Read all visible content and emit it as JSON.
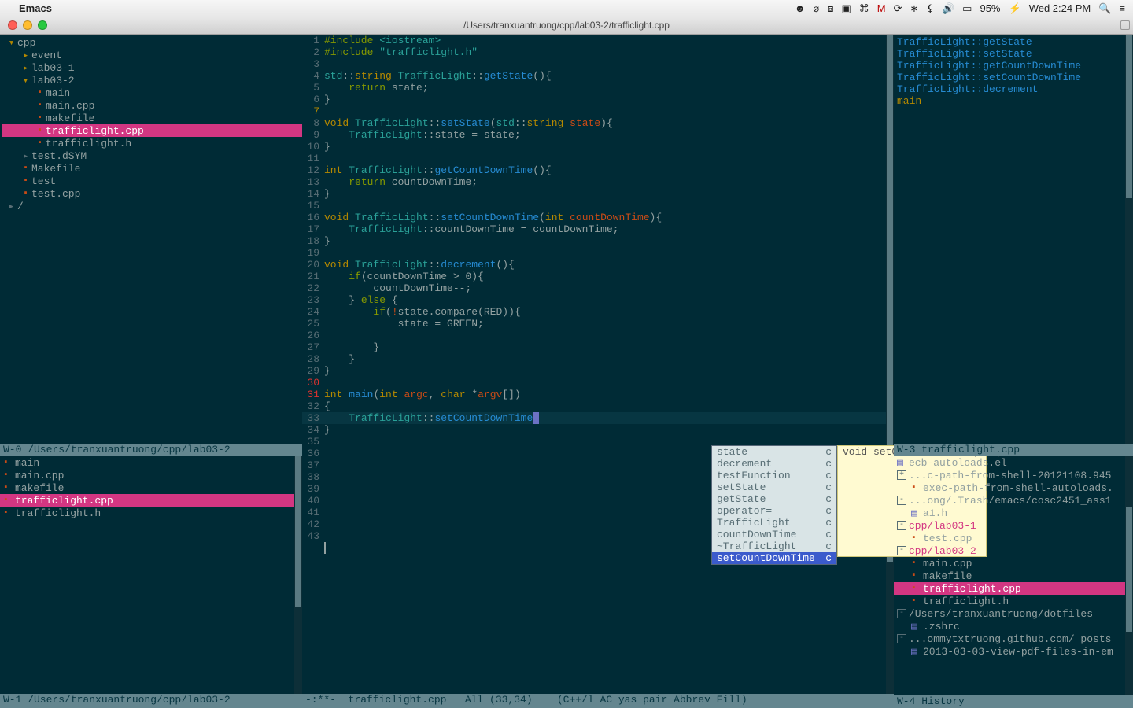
{
  "menubar": {
    "app_name": "Emacs",
    "status_battery": "95%",
    "status_clock": "Wed 2:24 PM"
  },
  "titlebar": {
    "path": "/Users/tranxuantruong/cpp/lab03-2/trafficlight.cpp"
  },
  "tree": {
    "root": "cpp",
    "items": [
      {
        "depth": 0,
        "kind": "folder-open",
        "label": "cpp"
      },
      {
        "depth": 1,
        "kind": "folder",
        "label": "event"
      },
      {
        "depth": 1,
        "kind": "folder",
        "label": "lab03-1"
      },
      {
        "depth": 1,
        "kind": "folder-open",
        "label": "lab03-2"
      },
      {
        "depth": 2,
        "kind": "file",
        "label": "main"
      },
      {
        "depth": 2,
        "kind": "file",
        "label": "main.cpp"
      },
      {
        "depth": 2,
        "kind": "file",
        "label": "makefile"
      },
      {
        "depth": 2,
        "kind": "file",
        "label": "trafficlight.cpp",
        "selected": true
      },
      {
        "depth": 2,
        "kind": "file",
        "label": "trafficlight.h"
      },
      {
        "depth": 1,
        "kind": "folder-grey",
        "label": "test.dSYM"
      },
      {
        "depth": 1,
        "kind": "file",
        "label": "Makefile"
      },
      {
        "depth": 1,
        "kind": "file",
        "label": "test"
      },
      {
        "depth": 1,
        "kind": "file",
        "label": "test.cpp"
      },
      {
        "depth": 0,
        "kind": "folder-grey",
        "label": "/"
      }
    ]
  },
  "file_history_header": "W-0 /Users/tranxuantruong/cpp/lab03-2",
  "file_history": [
    {
      "label": "main"
    },
    {
      "label": "main.cpp"
    },
    {
      "label": "makefile"
    },
    {
      "label": "trafficlight.cpp",
      "selected": true
    },
    {
      "label": "trafficlight.h"
    }
  ],
  "bottom_modeline": "W-1 /Users/tranxuantruong/cpp/lab03-2",
  "editor_modeline": "-:**-  trafficlight.cpp   All (33,34)    (C++/l AC yas pair Abbrev Fill)",
  "code": {
    "lines": [
      {
        "n": 1,
        "g": "",
        "html": "<span class='kw'>#include</span> <span class='str'>&lt;iostream&gt;</span>"
      },
      {
        "n": 2,
        "g": "",
        "html": "<span class='kw'>#include</span> <span class='str'>\"trafficlight.h\"</span>"
      },
      {
        "n": 3,
        "g": "",
        "html": ""
      },
      {
        "n": 4,
        "g": "",
        "html": "<span class='ns'>std</span>::<span class='type'>string</span> <span class='ns'>TrafficLight</span>::<span class='fn'>getState</span>(){"
      },
      {
        "n": 5,
        "g": "",
        "html": "    <span class='kw'>return</span> state;"
      },
      {
        "n": 6,
        "g": "",
        "html": "}"
      },
      {
        "n": 7,
        "g": "warn",
        "html": ""
      },
      {
        "n": 8,
        "g": "",
        "html": "<span class='type'>void</span> <span class='ns'>TrafficLight</span>::<span class='fn'>setState</span>(<span class='ns'>std</span>::<span class='type'>string</span> <span class='var'>state</span>){"
      },
      {
        "n": 9,
        "g": "",
        "html": "    <span class='ns'>TrafficLight</span>::state = state;"
      },
      {
        "n": 10,
        "g": "",
        "html": "}"
      },
      {
        "n": 11,
        "g": "",
        "html": ""
      },
      {
        "n": 12,
        "g": "",
        "html": "<span class='type'>int</span> <span class='ns'>TrafficLight</span>::<span class='fn'>getCountDownTime</span>(){"
      },
      {
        "n": 13,
        "g": "",
        "html": "    <span class='kw'>return</span> countDownTime;"
      },
      {
        "n": 14,
        "g": "",
        "html": "}"
      },
      {
        "n": 15,
        "g": "",
        "html": ""
      },
      {
        "n": 16,
        "g": "",
        "html": "<span class='type'>void</span> <span class='ns'>TrafficLight</span>::<span class='fn'>setCountDownTime</span>(<span class='type'>int</span> <span class='var'>countDownTime</span>){"
      },
      {
        "n": 17,
        "g": "",
        "html": "    <span class='ns'>TrafficLight</span>::countDownTime = countDownTime;"
      },
      {
        "n": 18,
        "g": "",
        "html": "}"
      },
      {
        "n": 19,
        "g": "",
        "html": ""
      },
      {
        "n": 20,
        "g": "",
        "html": "<span class='type'>void</span> <span class='ns'>TrafficLight</span>::<span class='fn'>decrement</span>(){"
      },
      {
        "n": 21,
        "g": "",
        "html": "    <span class='kw'>if</span>(countDownTime &gt; 0){"
      },
      {
        "n": 22,
        "g": "",
        "html": "        countDownTime--;"
      },
      {
        "n": 23,
        "g": "",
        "html": "    } <span class='kw'>else</span> {"
      },
      {
        "n": 24,
        "g": "",
        "html": "        <span class='kw'>if</span>(<span class='var'>!</span>state.compare(RED)){"
      },
      {
        "n": 25,
        "g": "",
        "html": "            state = GREEN;"
      },
      {
        "n": 26,
        "g": "",
        "html": ""
      },
      {
        "n": 27,
        "g": "",
        "html": "        }"
      },
      {
        "n": 28,
        "g": "",
        "html": "    }"
      },
      {
        "n": 29,
        "g": "",
        "html": "}"
      },
      {
        "n": 30,
        "g": "err",
        "html": ""
      },
      {
        "n": 31,
        "g": "err",
        "html": "<span class='type'>int</span> <span class='fn'>main</span>(<span class='type'>int</span> <span class='var'>argc</span>, <span class='type'>char</span> *<span class='var'>argv</span>[])"
      },
      {
        "n": 32,
        "g": "",
        "html": "{"
      },
      {
        "n": 33,
        "g": "",
        "hl": true,
        "html": "    <span class='ns'>TrafficLight</span>::<span class='fn'>setCountDownTime</span><span class='cursor-block' data-name='cursor' data-interactable='false'></span>"
      },
      {
        "n": 34,
        "g": "",
        "html": "}"
      },
      {
        "n": 35,
        "g": "",
        "html": ""
      },
      {
        "n": 36,
        "g": "",
        "html": ""
      },
      {
        "n": 37,
        "g": "",
        "html": ""
      },
      {
        "n": 38,
        "g": "",
        "html": ""
      },
      {
        "n": 39,
        "g": "",
        "html": ""
      },
      {
        "n": 40,
        "g": "",
        "html": ""
      },
      {
        "n": 41,
        "g": "",
        "html": ""
      },
      {
        "n": 42,
        "g": "",
        "html": ""
      },
      {
        "n": 43,
        "g": "",
        "html": ""
      }
    ]
  },
  "ac": {
    "items": [
      {
        "label": "state",
        "kind": "c"
      },
      {
        "label": "decrement",
        "kind": "c"
      },
      {
        "label": "testFunction",
        "kind": "c"
      },
      {
        "label": "setState",
        "kind": "c"
      },
      {
        "label": "getState",
        "kind": "c"
      },
      {
        "label": "operator=",
        "kind": "c"
      },
      {
        "label": "TrafficLight",
        "kind": "c"
      },
      {
        "label": "countDownTime",
        "kind": "c"
      },
      {
        "label": "~TrafficLight",
        "kind": "c"
      },
      {
        "label": "setCountDownTime",
        "kind": "c",
        "selected": true
      }
    ],
    "doc": "void setCountDownTime(int)"
  },
  "methods": [
    "TrafficLight::getState",
    "TrafficLight::setState",
    "TrafficLight::getCountDownTime",
    "TrafficLight::setCountDownTime",
    "TrafficLight::decrement",
    "main"
  ],
  "right_header_top": "W-3 trafficlight.cpp",
  "right_buffer_first": "ecb-autoloads.el",
  "right_buffers": [
    {
      "kind": "group",
      "exp": "+",
      "label": "...c-path-from-shell-20121108.945"
    },
    {
      "kind": "file",
      "label": "exec-path-from-shell-autoloads."
    },
    {
      "kind": "group",
      "exp": "-",
      "label": "...ong/.Trash/emacs/cosc2451_ass1"
    },
    {
      "kind": "file",
      "label": "a1.h",
      "elisp": true
    },
    {
      "kind": "group",
      "exp": "-",
      "label": "cpp/lab03-1",
      "mag": true
    },
    {
      "kind": "file",
      "label": "test.cpp"
    },
    {
      "kind": "group",
      "exp": "-",
      "label": "cpp/lab03-2",
      "mag": true
    },
    {
      "kind": "file",
      "label": "main.cpp"
    },
    {
      "kind": "file",
      "label": "makefile"
    },
    {
      "kind": "file",
      "label": "trafficlight.cpp",
      "selected": true
    },
    {
      "kind": "file",
      "label": "trafficlight.h"
    },
    {
      "kind": "group",
      "exp": "-",
      "label": "/Users/tranxuantruong/dotfiles"
    },
    {
      "kind": "file",
      "label": ".zshrc",
      "elisp": true
    },
    {
      "kind": "group",
      "exp": "-",
      "label": "...ommytxtruong.github.com/_posts"
    },
    {
      "kind": "file",
      "label": "2013-03-03-view-pdf-files-in-em",
      "elisp": true
    }
  ],
  "right_header_bottom": "W-4 History"
}
